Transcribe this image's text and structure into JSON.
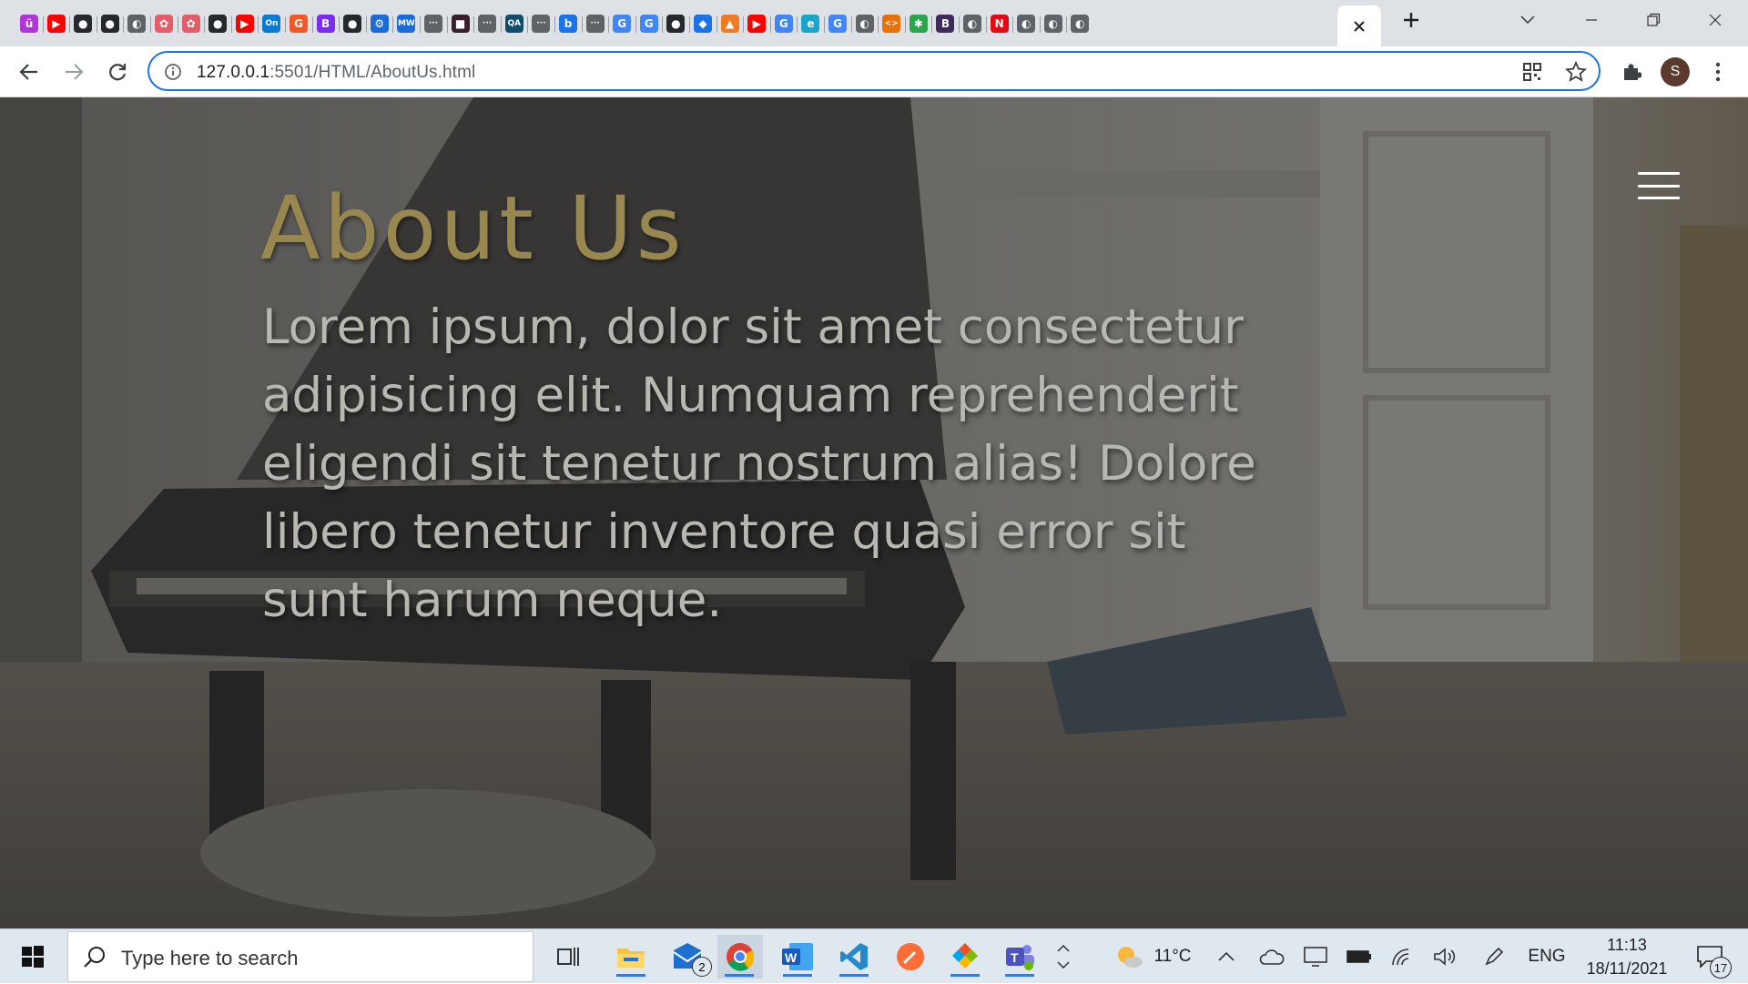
{
  "browser": {
    "tabs": [
      {
        "icon": "grammar-icon",
        "color": "#b036d6",
        "glyph": "ü"
      },
      {
        "icon": "youtube-icon",
        "color": "#ff0000",
        "glyph": "▶"
      },
      {
        "icon": "github-icon",
        "color": "#24292e",
        "glyph": "●"
      },
      {
        "icon": "github-icon",
        "color": "#24292e",
        "glyph": "●"
      },
      {
        "icon": "globe-icon",
        "color": "#5f6368",
        "glyph": "◐"
      },
      {
        "icon": "chatgpt-icon",
        "color": "#e35d6a",
        "glyph": "✿"
      },
      {
        "icon": "chatgpt-icon",
        "color": "#e35d6a",
        "glyph": "✿"
      },
      {
        "icon": "github-icon",
        "color": "#24292e",
        "glyph": "●"
      },
      {
        "icon": "youtube-icon",
        "color": "#ff0000",
        "glyph": "▶"
      },
      {
        "icon": "onenote-icon",
        "color": "#0a7ad3",
        "glyph": "On"
      },
      {
        "icon": "grammarly-icon",
        "color": "#f05a28",
        "glyph": "G"
      },
      {
        "icon": "bootstrap-icon",
        "color": "#7b2cf0",
        "glyph": "B"
      },
      {
        "icon": "github-icon",
        "color": "#24292e",
        "glyph": "●"
      },
      {
        "icon": "settings-icon",
        "color": "#1a6dd8",
        "glyph": "⚙"
      },
      {
        "icon": "mdn-icon",
        "color": "#1a6dd8",
        "glyph": "MW"
      },
      {
        "icon": "dots-icon",
        "color": "#5f6368",
        "glyph": "···"
      },
      {
        "icon": "app-icon",
        "color": "#3a1f2b",
        "glyph": "■"
      },
      {
        "icon": "dots-icon",
        "color": "#5f6368",
        "glyph": "···"
      },
      {
        "icon": "qa-icon",
        "color": "#0f4d6b",
        "glyph": "QA"
      },
      {
        "icon": "dots-icon",
        "color": "#5f6368",
        "glyph": "···"
      },
      {
        "icon": "bing-icon",
        "color": "#1a73e8",
        "glyph": "b"
      },
      {
        "icon": "dots-icon",
        "color": "#5f6368",
        "glyph": "···"
      },
      {
        "icon": "google-icon",
        "color": "#4285f4",
        "glyph": "G"
      },
      {
        "icon": "google-icon",
        "color": "#4285f4",
        "glyph": "G"
      },
      {
        "icon": "github-icon",
        "color": "#24292e",
        "glyph": "●"
      },
      {
        "icon": "diamond-icon",
        "color": "#1a73e8",
        "glyph": "◆"
      },
      {
        "icon": "figma-icon",
        "color": "#f07b22",
        "glyph": "▲"
      },
      {
        "icon": "youtube-icon",
        "color": "#ff0000",
        "glyph": "▶"
      },
      {
        "icon": "google-icon",
        "color": "#4285f4",
        "glyph": "G"
      },
      {
        "icon": "edge-icon",
        "color": "#1aa6c9",
        "glyph": "e"
      },
      {
        "icon": "google-icon",
        "color": "#4285f4",
        "glyph": "G"
      },
      {
        "icon": "globe-icon",
        "color": "#5f6368",
        "glyph": "◐"
      },
      {
        "icon": "code-icon",
        "color": "#e8710a",
        "glyph": "<>"
      },
      {
        "icon": "puzzle-icon",
        "color": "#2da44e",
        "glyph": "✱"
      },
      {
        "icon": "bootstrap-icon",
        "color": "#3d2b5b",
        "glyph": "B"
      },
      {
        "icon": "globe-icon",
        "color": "#5f6368",
        "glyph": "◐"
      },
      {
        "icon": "netflix-icon",
        "color": "#e50914",
        "glyph": "N"
      },
      {
        "icon": "globe-icon",
        "color": "#5f6368",
        "glyph": "◐"
      },
      {
        "icon": "globe-icon",
        "color": "#5f6368",
        "glyph": "◐"
      },
      {
        "icon": "globe-icon",
        "color": "#5f6368",
        "glyph": "◐"
      }
    ],
    "url_host": "127.0.0.1",
    "url_path": ":5501/HTML/AboutUs.html",
    "profile_initial": "S"
  },
  "page": {
    "title": "About Us",
    "body": "Lorem ipsum, dolor sit amet consectetur adipisicing elit. Numquam reprehenderit eligendi sit tenetur nostrum alias! Dolore libero tenetur inventore quasi error sit sunt harum neque."
  },
  "taskbar": {
    "search_placeholder": "Type here to search",
    "mail_badge": "2",
    "weather": "11°C",
    "language": "ENG",
    "time": "11:13",
    "date": "18/11/2021",
    "notifications": "17"
  }
}
